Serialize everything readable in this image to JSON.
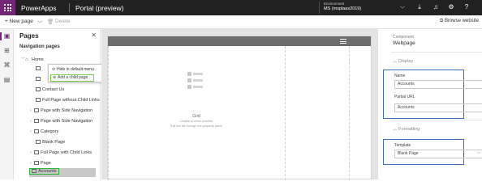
{
  "topbar": {
    "app_name": "PowerApps",
    "portal_title": "Portal (preview)",
    "environment_label": "Environment",
    "environment_value": "MS (msplaax2019)"
  },
  "commandbar": {
    "new_page": "+ New page",
    "delete": "Delete",
    "browse_website": "Browse website"
  },
  "pages_panel": {
    "title": "Pages",
    "navigation_label": "Navigation pages",
    "items": [
      {
        "label": "Home"
      },
      {
        "label": ""
      },
      {
        "label": ""
      },
      {
        "label": "Contact Us"
      },
      {
        "label": "Full Page without Child Links"
      },
      {
        "label": "Page with Side Navigation"
      },
      {
        "label": "Page with Side Navigation"
      },
      {
        "label": "Category"
      },
      {
        "label": "Blank Page"
      },
      {
        "label": "Full Page with Child Links"
      },
      {
        "label": "Page"
      },
      {
        "label": "Accounts"
      }
    ]
  },
  "context_menu": {
    "hide": "Hide in default menu",
    "add_child": "Add a child page"
  },
  "canvas": {
    "grid_title": "Grid",
    "grid_line1": "Unable to show preview",
    "grid_line2": "Edit the list through the property panel"
  },
  "properties": {
    "component_label": "Component",
    "component_value": "Webpage",
    "display_section": "Display",
    "name_label": "Name",
    "name_value": "Accounts",
    "partial_url_label": "Partial URL",
    "partial_url_value": "Accounts",
    "formatting_section": "Formatting",
    "template_label": "Template",
    "template_value": "Blank Page"
  },
  "colors": {
    "brand": "#742774",
    "highlight_green": "#2bb03a",
    "highlight_blue": "#3e6fb8"
  }
}
